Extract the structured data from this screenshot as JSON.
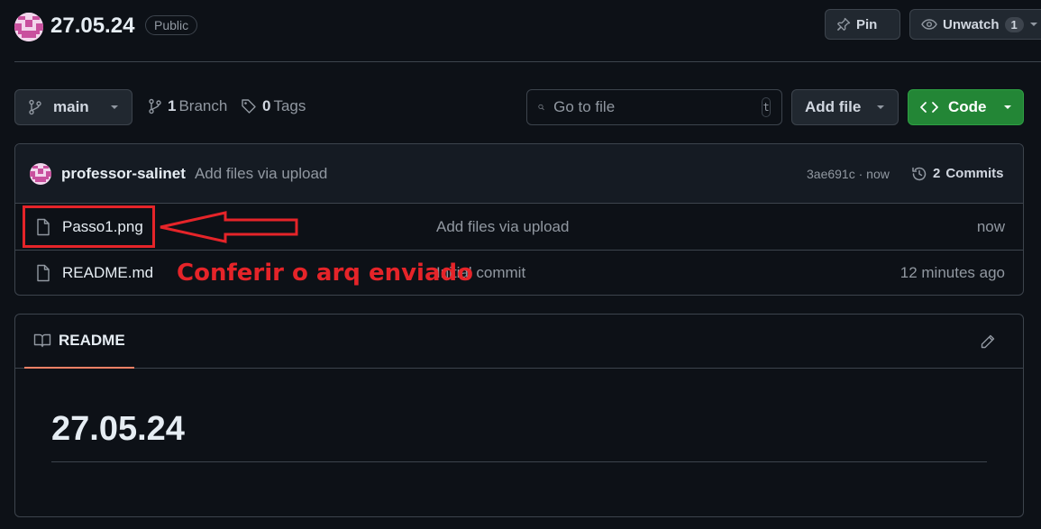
{
  "repo": {
    "name": "27.05.24",
    "visibility": "Public",
    "pin_label": "Pin",
    "watch_label": "Unwatch",
    "watch_count": "1"
  },
  "toolbar": {
    "branch": "main",
    "branches_count": "1",
    "branches_label": "Branch",
    "tags_count": "0",
    "tags_label": "Tags",
    "search_placeholder": "Go to file",
    "search_shortcut": "t",
    "add_file_label": "Add file",
    "code_label": "Code"
  },
  "latest_commit": {
    "author": "professor-salinet",
    "message": "Add files via upload",
    "hash_time": "3ae691c · now",
    "commits_count": "2",
    "commits_label": "Commits"
  },
  "files": [
    {
      "name": "Passo1.png",
      "message": "Add files via upload",
      "time": "now"
    },
    {
      "name": "README.md",
      "message": "Initial commit",
      "time": "12 minutes ago"
    }
  ],
  "readme": {
    "tab_label": "README",
    "title": "27.05.24"
  },
  "annotation": {
    "text": "Conferir o arq enviado",
    "color": "#e52429"
  },
  "colors": {
    "background": "#0d1117",
    "border": "#3d444d",
    "code_button": "#238636",
    "readme_tab_underline": "#f78166"
  }
}
